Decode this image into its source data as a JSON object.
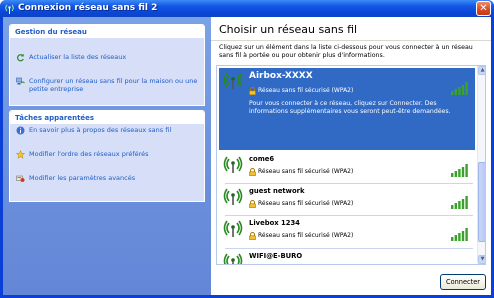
{
  "window": {
    "title": "Connexion réseau sans fil 2",
    "close_label": "✕"
  },
  "left": {
    "network_tasks": {
      "header": "Gestion du réseau",
      "items": [
        {
          "label": "Actualiser la liste des réseaux",
          "icon": "refresh-icon"
        },
        {
          "label": "Configurer un réseau sans fil pour la maison ou une petite entreprise",
          "icon": "setup-network-icon"
        }
      ]
    },
    "related_tasks": {
      "header": "Tâches apparentées",
      "items": [
        {
          "label": "En savoir plus à propos des réseaux sans fil",
          "icon": "info-icon"
        },
        {
          "label": "Modifier l'ordre des réseaux préférés",
          "icon": "star-icon"
        },
        {
          "label": "Modifier les paramètres avancés",
          "icon": "settings-icon"
        }
      ]
    }
  },
  "main": {
    "heading": "Choisir un réseau sans fil",
    "intro": "Cliquez sur un élément dans la liste ci-dessous pour vous connecter à un réseau sans fil à portée ou pour obtenir plus d'informations.",
    "networks": [
      {
        "name": "Airbox-XXXX",
        "security": "Réseau sans fil sécurisé (WPA2)",
        "description": "Pour vous connecter à ce réseau, cliquez sur Connecter. Des informations supplémentaires vous seront peut-être demandées.",
        "selected": true,
        "signal_bars": 5
      },
      {
        "name": "come6",
        "security": "Réseau sans fil sécurisé (WPA2)",
        "selected": false,
        "signal_bars": 5
      },
      {
        "name": "guest network",
        "security": "Réseau sans fil sécurisé (WPA2)",
        "selected": false,
        "signal_bars": 5
      },
      {
        "name": "Livebox 1234",
        "security": "Réseau sans fil sécurisé (WPA2)",
        "selected": false,
        "signal_bars": 5
      },
      {
        "name": "WIFI@E-BURO",
        "security": "",
        "selected": false,
        "signal_bars": 0
      }
    ],
    "connect_label": "Connecter"
  },
  "colors": {
    "selection": "#316ac5",
    "link": "#215dc6",
    "signal": "#3aa12b",
    "titlebar": "#0a48da"
  }
}
